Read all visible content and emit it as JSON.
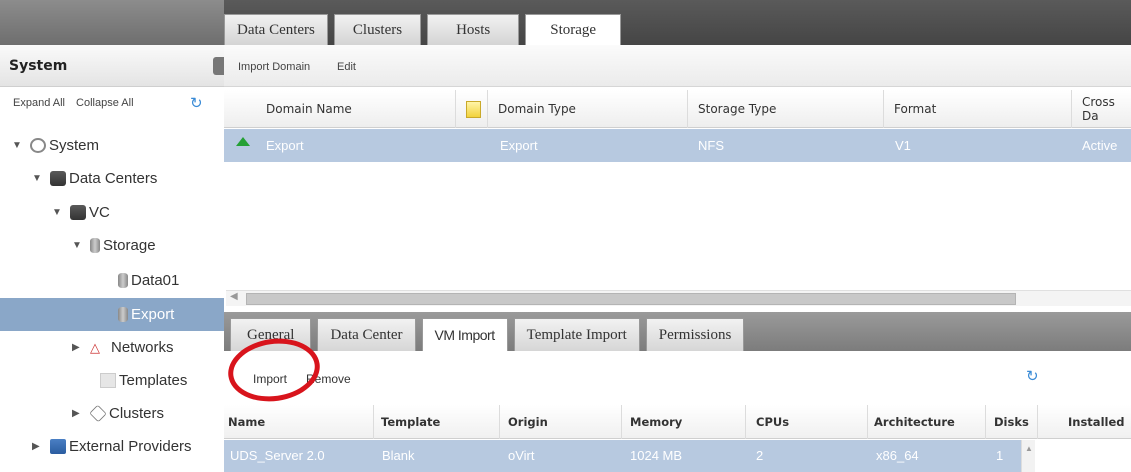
{
  "main_tabs": [
    "Data Centers",
    "Clusters",
    "Hosts",
    "Storage"
  ],
  "system_panel": {
    "title": "System",
    "expand_all": "Expand All",
    "collapse_all": "Collapse All",
    "tree": {
      "system": "System",
      "data_centers": "Data Centers",
      "vc": "VC",
      "storage": "Storage",
      "data01": "Data01",
      "export": "Export",
      "networks": "Networks",
      "templates": "Templates",
      "clusters": "Clusters",
      "external_providers": "External Providers"
    }
  },
  "domain_toolbar": {
    "import_domain": "Import Domain",
    "edit": "Edit"
  },
  "domain_grid": {
    "columns": [
      "Domain Name",
      "Domain Type",
      "Storage Type",
      "Format",
      "Cross Da"
    ],
    "rows": [
      {
        "name": "Export",
        "type": "Export",
        "storage_type": "NFS",
        "format": "V1",
        "cross": "Active"
      }
    ]
  },
  "sub_tabs": [
    "General",
    "Data Center",
    "VM Import",
    "Template Import",
    "Permissions"
  ],
  "vm_toolbar": {
    "import": "Import",
    "remove": "Remove"
  },
  "vm_grid": {
    "columns": [
      "Name",
      "Template",
      "Origin",
      "Memory",
      "CPUs",
      "Architecture",
      "Disks",
      "Installed"
    ],
    "rows": [
      {
        "name": "UDS_Server 2.0",
        "template": "Blank",
        "origin": "oVirt",
        "memory": "1024 MB",
        "cpus": "2",
        "arch": "x86_64",
        "disks": "1"
      }
    ]
  },
  "colors": {
    "selection": "#b7c9e0",
    "tree_selection": "#8aa7c8",
    "annotation_circle": "#d8141c",
    "status_up": "#25a035"
  }
}
